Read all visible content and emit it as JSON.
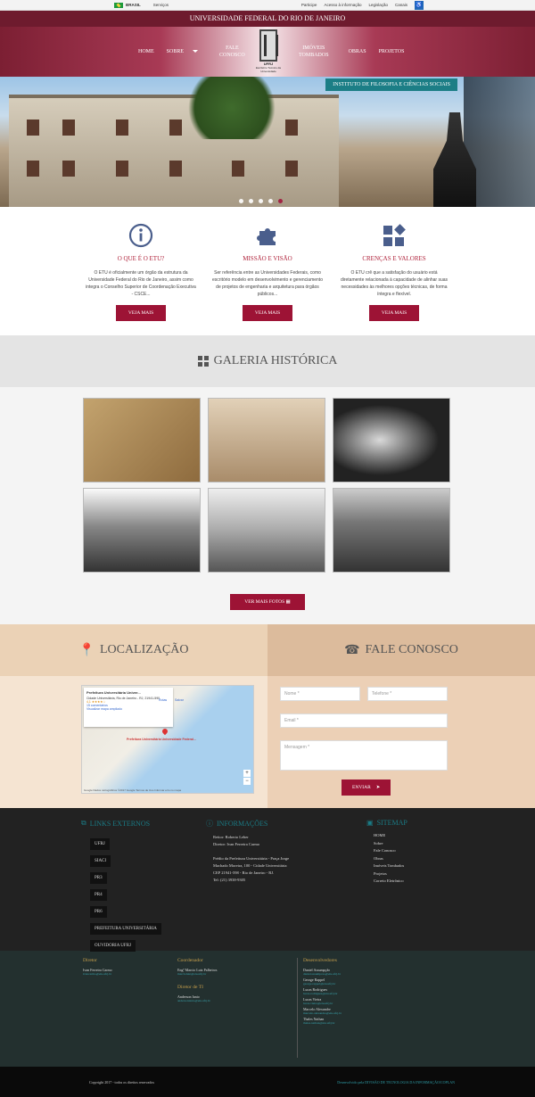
{
  "gov": {
    "country": "BRASIL",
    "services": "Serviços",
    "links": [
      "Participe",
      "Acesso à informação",
      "Legislação",
      "Canais"
    ],
    "acc": "♿"
  },
  "header": {
    "university": "UNIVERSIDADE FEDERAL DO RIO DE JANEIRO"
  },
  "nav": {
    "left": [
      "HOME",
      "SOBRE"
    ],
    "contact": [
      "FALE",
      "CONOSCO"
    ],
    "right1": [
      "IMÓVEIS",
      "TOMBADOS"
    ],
    "right2": [
      "OBRAS",
      "PROJETOS"
    ],
    "logo_caption": "Escritório Técnico da Universidade",
    "logo_text": "UFRJ"
  },
  "hero": {
    "institute": "INSTITUTO DE FILOSOFIA E CIÊNCIAS SOCIAIS",
    "slides": 5,
    "active": 4
  },
  "features": [
    {
      "icon": "info-icon",
      "title": "O QUE É O ETU?",
      "text": "O ETU é oficialmente um órgão da estrutura da Universidade Federal do Rio de Janeiro, assim como integra o Conselho Superior de Coordenação Executiva - CSCE...",
      "btn": "VEJA MAIS"
    },
    {
      "icon": "puzzle-icon",
      "title": "MISSÃO E VISÃO",
      "text": "Ser referência entre as Universidades Federais, como escritório modelo em desenvolvimento e gerenciamento de projetos de engenharia e arquitetura para órgãos públicos...",
      "btn": "VEJA MAIS"
    },
    {
      "icon": "shapes-icon",
      "title": "CRENÇAS E VALORES",
      "text": "O ETU crê que a satisfação do usuário está diretamente relacionada à capacidade de alinhar suas necessidades às melhores opções técnicas, de forma íntegra e flexível.",
      "btn": "VEJA MAIS"
    }
  ],
  "gallery": {
    "title": "GALERIA HISTÓRICA",
    "photos": [
      "map-photo-1",
      "cidade-universitaria-photo",
      "aerial-map-photo",
      "campus-landscape-photo",
      "hospicio-alienados-photo",
      "crowd-building-photo"
    ],
    "btn": "VER MAIS FOTOS"
  },
  "location": {
    "title": "LOCALIZAÇÃO",
    "map_title": "Prefeitura Universitária Univer...",
    "map_addr": "Cidade Universitária, Rio de Janeiro - RJ, 21941-590",
    "rating": "4,1 ★★★★☆",
    "reviews": "15 comentários",
    "bigger": "Visualizar mapa ampliado",
    "marker": "Prefeitura Universitária Universidade Federal...",
    "routes": "Rotas",
    "save": "Salvar",
    "footer": "Google   Dados cartográficos ©2017 Google   Termos de Uso   Informar erro no mapa"
  },
  "contact": {
    "title": "FALE CONOSCO",
    "name": "Nome *",
    "phone": "Telefone *",
    "email": "Email *",
    "message": "Mensagem *",
    "send": "ENVIAR"
  },
  "footer": {
    "links_title": "LINKS EXTERNOS",
    "links": [
      "UFRJ",
      "SIACI",
      "PR3",
      "PR4",
      "PR6",
      "PREFEITURA UNIVERSITÁRIA",
      "OUVIDORIA UFRJ"
    ],
    "info_title": "INFORMAÇÕES",
    "info": [
      "Reitor: Roberto Leher",
      "Diretor: Ivan Ferreira Carmo",
      "",
      "Prédio da Prefeitura Universitária - Praça Jorge",
      "Machado Moreira, 100 - Cidade Universitária",
      "CEP 21941-598 - Rio de Janeiro - RJ.",
      "Tel: (21) 3938-9305"
    ],
    "sitemap_title": "SITEMAP",
    "sitemap": [
      "HOME",
      "Sobre",
      "Fale Conosco",
      "Obras",
      "Imóveis Tombados",
      "Projetos",
      "Correio Eletrônico"
    ]
  },
  "team": {
    "director_h": "Diretor",
    "director": "Ivan Ferreira Carmo",
    "director_e": "ivancarmo@etu.ufrj.br",
    "coord_h": "Coordenador",
    "coord": "Engº Marcio Luiz Palheiros",
    "coord_e": "marcioluiz@etu.ufrj.br",
    "ti_h": "Diretor de TI",
    "ti": "Anderson Ianio",
    "ti_e": "andersonianio@etu.ufrj.br",
    "dev_h": "Desenvolvedores",
    "devs": [
      {
        "n": "Daniel Assumpção",
        "e": "daniel.assumpcao@etu.ufrj.br"
      },
      {
        "n": "George Rappel",
        "e": "george.rappel@etu.ufrj.br"
      },
      {
        "n": "Lucas Rodrigues",
        "e": "lucas.rodrigues@etu.ufrj.br"
      },
      {
        "n": "Lucas Vieira",
        "e": "lucas.vieira@etu.ufrj.br"
      },
      {
        "n": "Marcelo Alexandre",
        "e": "marcelo.alexandre@etu.ufrj.br"
      },
      {
        "n": "Thales Nathan",
        "e": "thales.nathan@etu.ufrj.br"
      }
    ]
  },
  "bottom": {
    "copy": "Copyright 2017 - todos os direitos reservados",
    "dev_pre": "Desenvolvido pela",
    "dev": "DIVISÃO DE TECNOLOGIA DA INFORMAÇÃO/COPLAN"
  },
  "colors": {
    "brand": "#9d1335",
    "teal": "#1c7e86"
  }
}
